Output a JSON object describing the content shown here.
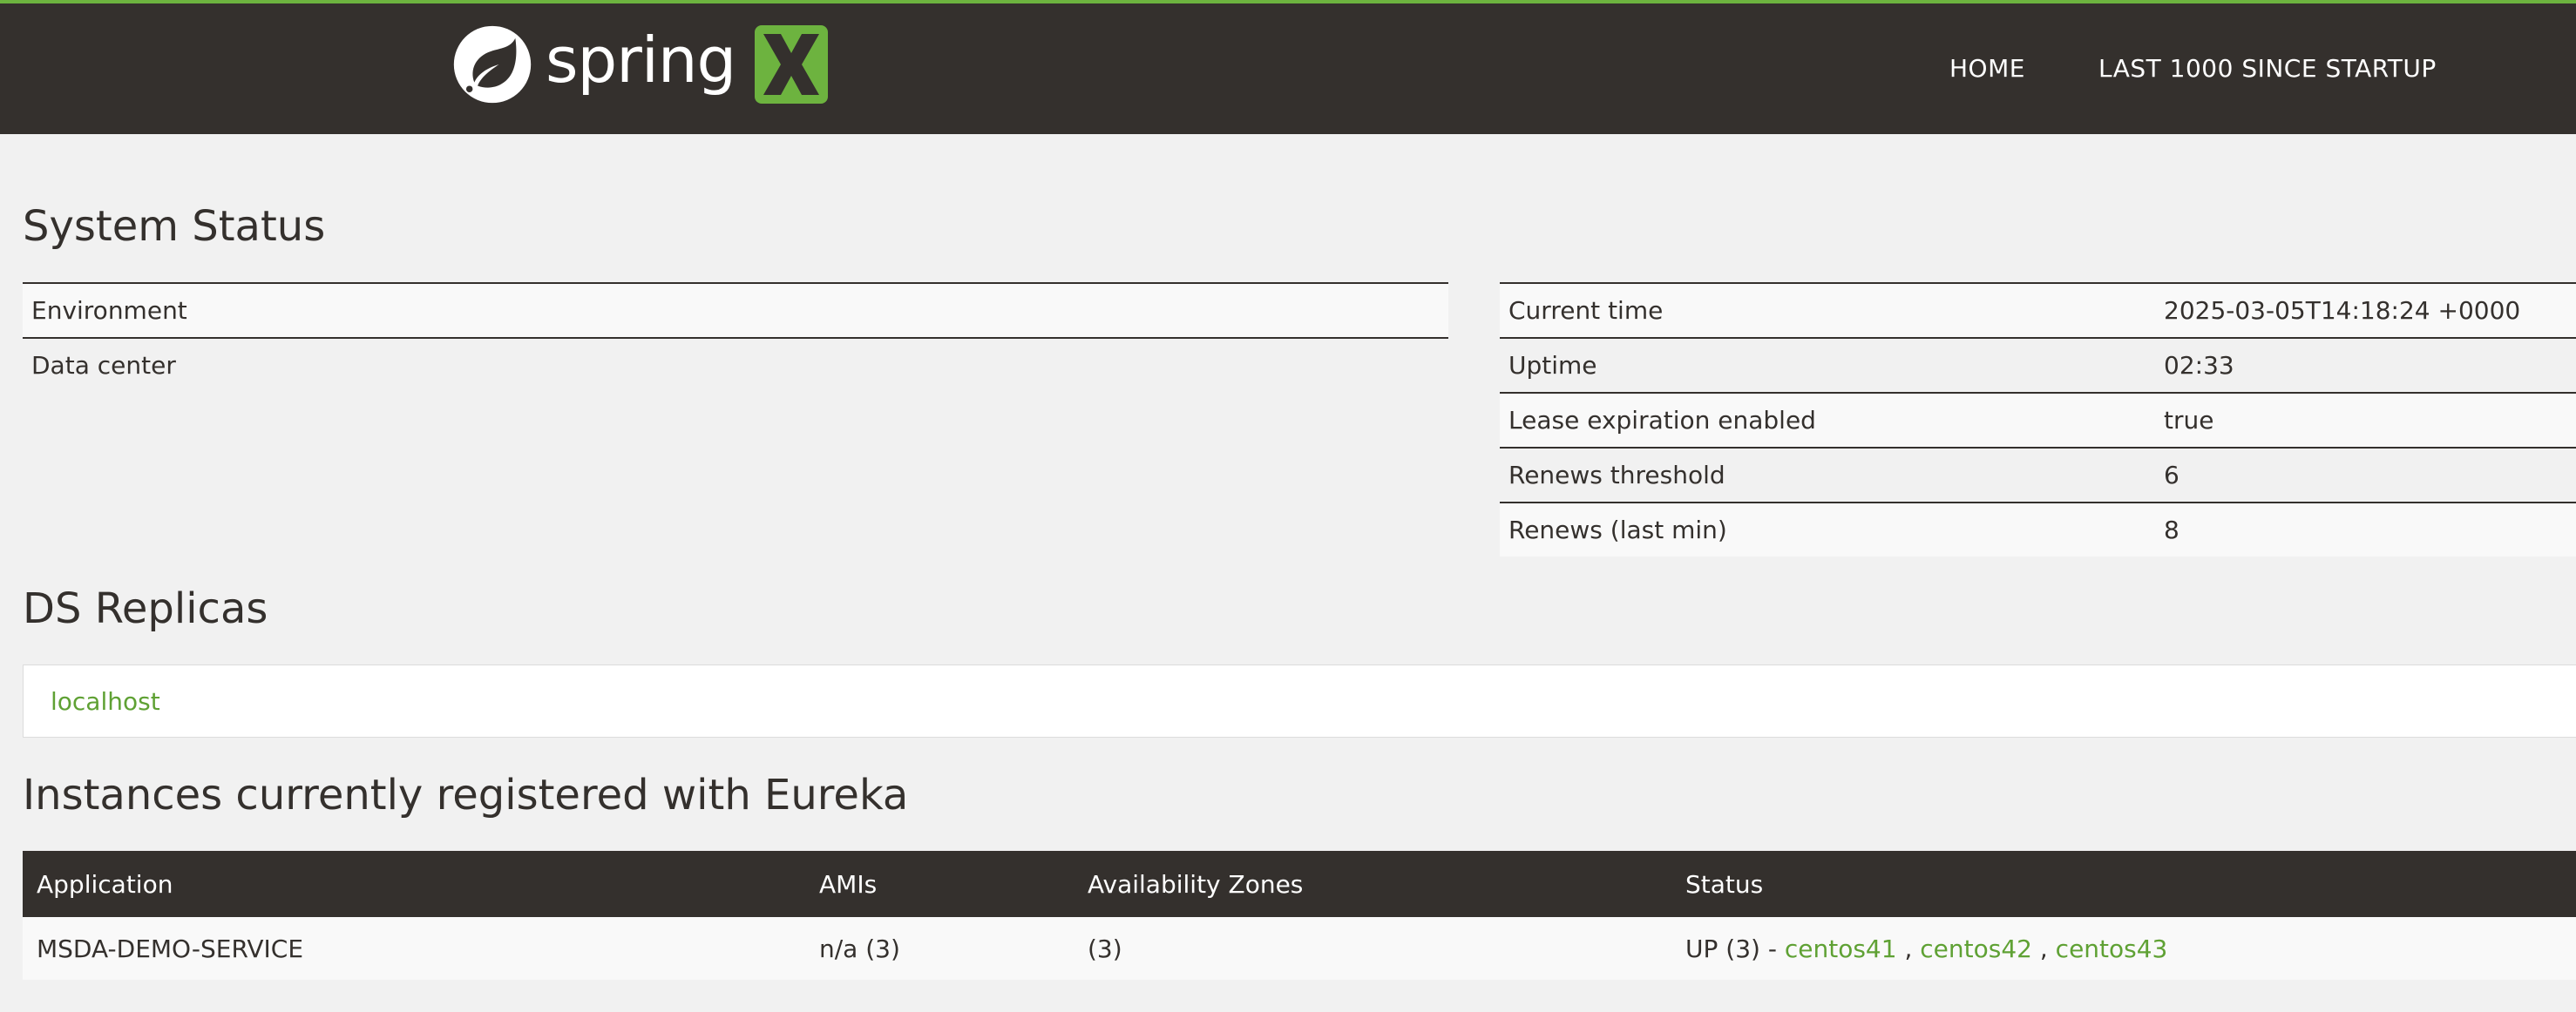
{
  "brand": {
    "logo_word": "spring",
    "logo_mark": "X",
    "accent_color": "#6db33f",
    "header_bg": "#34302d"
  },
  "nav": {
    "home": "HOME",
    "last": "LAST 1000 SINCE STARTUP"
  },
  "system_status": {
    "title": "System Status",
    "left": [
      {
        "key": "Environment",
        "value": ""
      },
      {
        "key": "Data center",
        "value": ""
      }
    ],
    "right": [
      {
        "key": "Current time",
        "value": "2025-03-05T14:18:24 +0000"
      },
      {
        "key": "Uptime",
        "value": "02:33"
      },
      {
        "key": "Lease expiration enabled",
        "value": "true"
      },
      {
        "key": "Renews threshold",
        "value": "6"
      },
      {
        "key": "Renews (last min)",
        "value": "8"
      }
    ]
  },
  "ds_replicas": {
    "title": "DS Replicas",
    "items": [
      "localhost"
    ]
  },
  "instances": {
    "title": "Instances currently registered with Eureka",
    "columns": [
      "Application",
      "AMIs",
      "Availability Zones",
      "Status"
    ],
    "rows": [
      {
        "application": "MSDA-DEMO-SERVICE",
        "amis": "n/a (3)",
        "zones": "(3)",
        "status_prefix": "UP (3) - ",
        "instances": [
          "centos41",
          "centos42",
          "centos43"
        ],
        "separator": " , "
      }
    ]
  }
}
